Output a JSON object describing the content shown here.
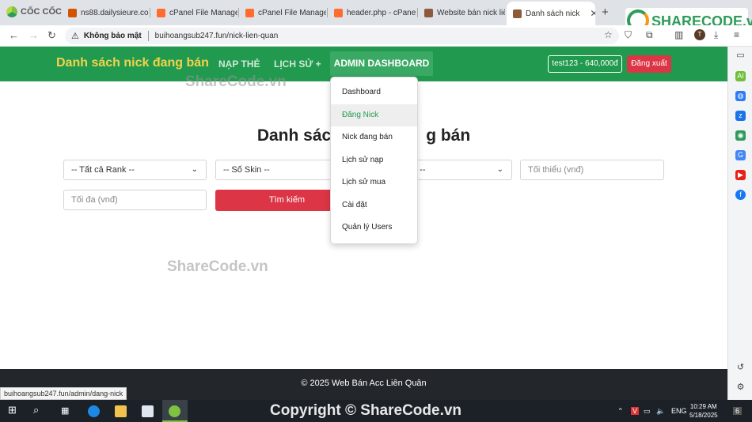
{
  "browser": {
    "brand": "CỐC CỐC",
    "tabs": [
      {
        "label": "ns88.dailysieure.com",
        "color": "#d35400"
      },
      {
        "label": "cPanel File Manager",
        "color": "#ff6c2c"
      },
      {
        "label": "cPanel File Manager",
        "color": "#ff6c2c"
      },
      {
        "label": "header.php - cPanel",
        "color": "#ff6c2c"
      },
      {
        "label": "Website bán nick liê",
        "color": "#8e5a3a"
      },
      {
        "label": "Danh sách nick",
        "color": "#8e5a3a"
      }
    ],
    "address": {
      "security_label": "Không bảo mật",
      "url": "buihoangsub247.fun/nick-lien-quan"
    },
    "profile_initial": "T",
    "status_url": "buihoangsub247.fun/admin/dang-nick"
  },
  "site": {
    "title": "Danh sách nick đang bán",
    "menu": {
      "nap_the": "NẠP THẺ",
      "lich_su": "LỊCH SỬ +",
      "admin": "ADMIN DASHBOARD +"
    },
    "user": "test123 - 640,000đ",
    "logout": "Đăng xuất",
    "dropdown": [
      "Dashboard",
      "Đăng Nick",
      "Nick đang bán",
      "Lịch sử nạp",
      "Lịch sử mua",
      "Cài đặt",
      "Quản lý Users"
    ],
    "heading_left": "Danh sác",
    "heading_right": "g bán",
    "filters": {
      "rank": "-- Tất cả Rank --",
      "skin": "-- Số Skin --",
      "status_partial": "g --",
      "min_placeholder": "Tối thiểu (vnđ)",
      "max_placeholder": "Tối đa (vnđ)",
      "search": "Tìm kiếm"
    },
    "footer": "© 2025 Web Bán Acc Liên Quân"
  },
  "watermarks": {
    "top": "ShareCode.vn",
    "middle": "ShareCode.vn",
    "bottom": "Copyright © ShareCode.vn",
    "logo": "SHARECODE.vn"
  },
  "taskbar": {
    "lang": "ENG",
    "time": "10:29 AM",
    "date": "5/18/2025",
    "notif_count": "6"
  }
}
